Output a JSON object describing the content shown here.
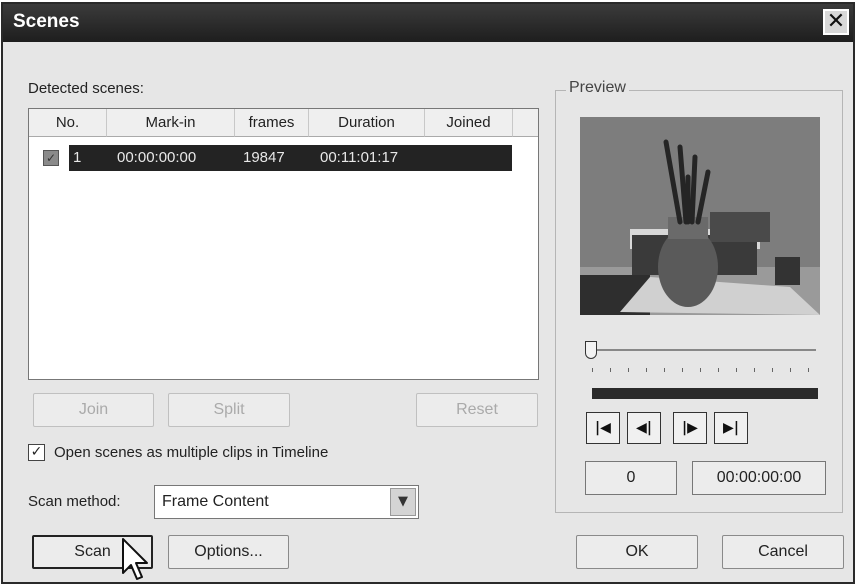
{
  "window": {
    "title": "Scenes",
    "close_glyph": "✕"
  },
  "scenes": {
    "label": "Detected scenes:",
    "columns": [
      "No.",
      "Mark-in",
      "frames",
      "Duration",
      "Joined"
    ],
    "rows": [
      {
        "checked": true,
        "no": "1",
        "mark_in": "00:00:00:00",
        "frames": "19847",
        "duration": "00:11:01:17",
        "joined": ""
      }
    ]
  },
  "buttons": {
    "join": "Join",
    "split": "Split",
    "reset": "Reset",
    "scan": "Scan",
    "options": "Options...",
    "ok": "OK",
    "cancel": "Cancel"
  },
  "options": {
    "multiple_clips_checked": true,
    "multiple_clips_label": "Open scenes as multiple clips in Timeline",
    "scan_method_label": "Scan method:",
    "scan_method_value": "Frame Content"
  },
  "preview": {
    "label": "Preview",
    "slider_position": 0,
    "frame_number": "0",
    "timecode": "00:00:00:00",
    "nav_icons": [
      "go-to-start-icon",
      "step-back-icon",
      "step-forward-icon",
      "go-to-end-icon"
    ]
  }
}
